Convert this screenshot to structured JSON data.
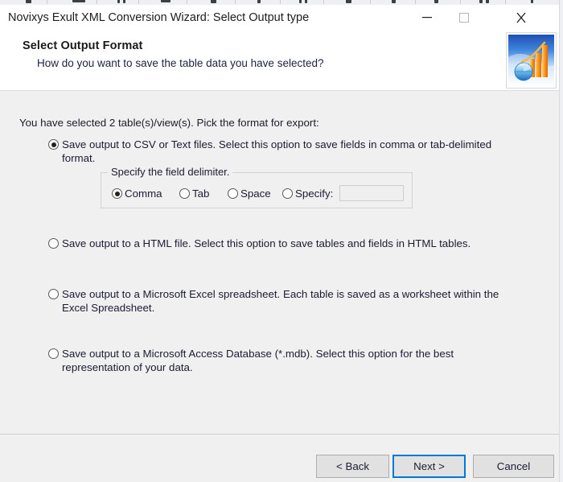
{
  "window": {
    "title": "Novixys Exult XML Conversion Wizard: Select Output type",
    "minimize_label": "Minimize",
    "maximize_label": "Maximize",
    "close_label": "Close",
    "accent_color": "#0078d7",
    "titlebar_bg": "#ffffff",
    "body_bg": "#f0f0f0"
  },
  "header": {
    "title": "Select Output Format",
    "subtitle": "How do you want to save the table data you have selected?",
    "logo_name": "exult-chart-logo"
  },
  "main": {
    "intro": "You have selected 2 table(s)/view(s). Pick the format for export:",
    "options": [
      {
        "id": "csv",
        "label": "Save output to CSV or Text files. Select this option to save fields in comma or tab-delimited format.",
        "selected": true
      },
      {
        "id": "html",
        "label": "Save output to a HTML file. Select this option to save tables and fields in HTML tables.",
        "selected": false
      },
      {
        "id": "excel",
        "label": "Save output to a Microsoft Excel spreadsheet. Each table is saved as a worksheet within the Excel Spreadsheet.",
        "selected": false
      },
      {
        "id": "access",
        "label": "Save output to a Microsoft Access Database (*.mdb). Select this option for the best representation of your data.",
        "selected": false
      }
    ],
    "delimiter_group": {
      "legend": "Specify the field delimiter.",
      "options": [
        {
          "id": "comma",
          "label": "Comma",
          "selected": true
        },
        {
          "id": "tab",
          "label": "Tab",
          "selected": false
        },
        {
          "id": "space",
          "label": "Space",
          "selected": false
        },
        {
          "id": "specify",
          "label": "Specify:",
          "selected": false
        }
      ],
      "specify_value": "",
      "specify_placeholder": ""
    }
  },
  "footer": {
    "back_label": "< Back",
    "next_label": "Next >",
    "cancel_label": "Cancel",
    "default_button": "Next >"
  }
}
